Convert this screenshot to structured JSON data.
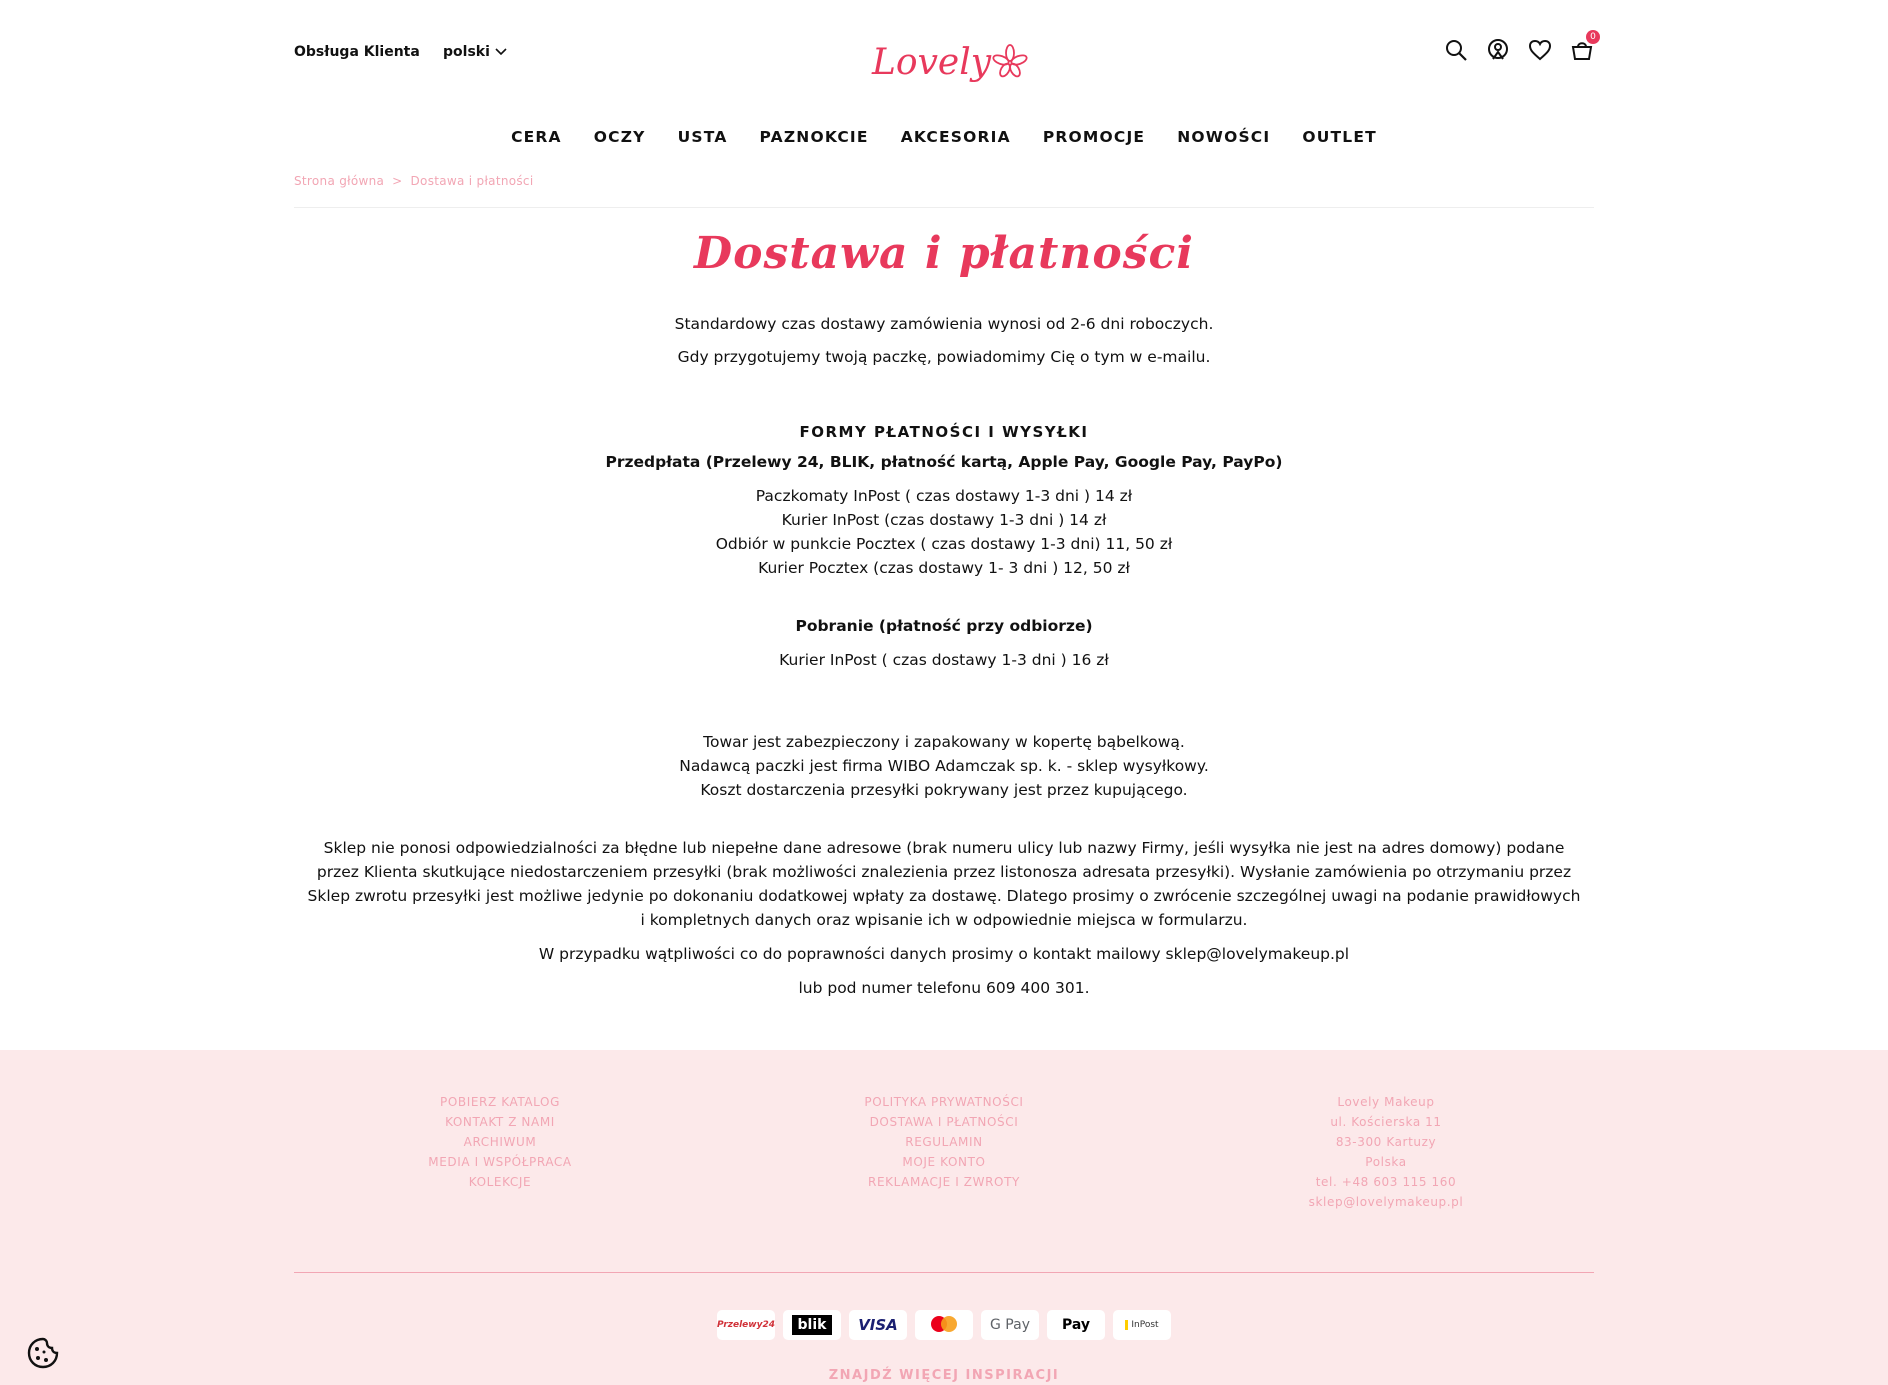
{
  "header": {
    "service_label": "Obsługa Klienta",
    "language": "polski",
    "logo_text": "Lovely",
    "cart_count": "0",
    "accent_color": "#e8395c"
  },
  "nav": {
    "items": [
      "CERA",
      "OCZY",
      "USTA",
      "PAZNOKCIE",
      "AKCESORIA",
      "PROMOCJE",
      "NOWOŚCI",
      "OUTLET"
    ]
  },
  "breadcrumb": {
    "home": "Strona główna",
    "separator": ">",
    "current": "Dostawa i płatności"
  },
  "page": {
    "title": "Dostawa i płatności",
    "std_time": "Standardowy czas dostawy zamówienia wynosi od 2-6 dni roboczych.",
    "email_notice": "Gdy przygotujemy twoją paczkę, powiadomimy Cię o tym w e-mailu.",
    "forms_heading": "FORMY PŁATNOŚCI I WYSYŁKI",
    "prepaid_heading": "Przedpłata (Przelewy 24, BLIK, płatność kartą, Apple Pay, Google Pay, PayPo)",
    "prepaid_options": [
      "Paczkomaty InPost ( czas dostawy 1-3 dni ) 14 zł",
      "Kurier InPost (czas dostawy 1-3 dni ) 14 zł",
      "Odbiór w punkcie Pocztex ( czas dostawy 1-3 dni) 11, 50 zł",
      "Kurier Pocztex (czas dostawy 1- 3 dni ) 12, 50 zł"
    ],
    "cod_heading": "Pobranie (płatność przy odbiorze)",
    "cod_options": [
      "Kurier InPost ( czas dostawy 1-3 dni ) 16 zł"
    ],
    "goods_lines": [
      "Towar jest zabezpieczony i zapakowany w kopertę bąbelkową.",
      "Nadawcą paczki jest firma WIBO Adamczak sp. k. - sklep wysyłkowy.",
      "Koszt dostarczenia przesyłki pokrywany jest przez kupującego."
    ],
    "responsibility": "Sklep nie ponosi odpowiedzialności za błędne lub niepełne dane adresowe (brak numeru ulicy lub nazwy Firmy, jeśli wysyłka nie jest na adres domowy) podane przez Klienta skutkujące niedostarczeniem przesyłki (brak możliwości znalezienia przez listonosza adresata przesyłki). Wysłanie zamówienia po otrzymaniu przez Sklep zwrotu przesyłki jest możliwe jedynie po dokonaniu dodatkowej wpłaty za dostawę. Dlatego prosimy o zwrócenie szczególnej uwagi na podanie prawidłowych i kompletnych danych oraz wpisanie ich w odpowiednie miejsca w formularzu.",
    "doubt": "W przypadku wątpliwości co do poprawności danych prosimy o kontakt mailowy sklep@lovelymakeup.pl",
    "phone": "lub pod numer telefonu 609 400 301."
  },
  "footer": {
    "col1": [
      "POBIERZ KATALOG",
      "KONTAKT Z NAMI",
      "ARCHIWUM",
      "MEDIA I WSPÓŁPRACA",
      "KOLEKCJE"
    ],
    "col2": [
      "POLITYKA PRYWATNOŚCI",
      "DOSTAWA I PŁATNOŚCI",
      "REGULAMIN",
      "MOJE KONTO",
      "REKLAMACJE I ZWROTY"
    ],
    "col3": [
      "Lovely Makeup",
      "ul. Kościerska 11",
      "83-300 Kartuzy",
      "Polska",
      "tel. +48 603 115 160",
      "sklep@lovelymakeup.pl"
    ],
    "payments": [
      "Przelewy24",
      "blik",
      "VISA",
      "mastercard",
      "G Pay",
      "Pay",
      "InPost"
    ],
    "more": "ZNAJDŹ WIĘCEJ INSPIRACJI",
    "bg_color": "#fce9ea",
    "text_color": "#f2a6b4"
  }
}
